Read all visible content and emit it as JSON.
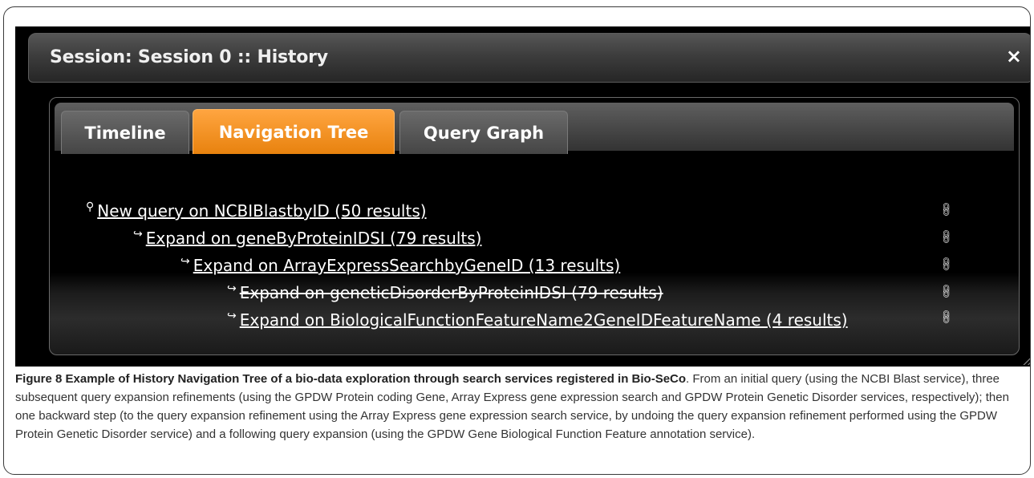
{
  "window": {
    "title": "Session: Session 0 :: History",
    "close_glyph": "×"
  },
  "tabs": [
    {
      "label": "Timeline",
      "active": false
    },
    {
      "label": "Navigation Tree",
      "active": true
    },
    {
      "label": "Query Graph",
      "active": false
    }
  ],
  "tree": [
    {
      "glyph": "⚲",
      "label": "New query on NCBIBlastbyID (50 results)",
      "icon": "link-icon",
      "struck": false
    },
    {
      "glyph": "↪",
      "label": "Expand on geneByProteinIDSI (79 results)",
      "icon": "link-icon",
      "struck": false
    },
    {
      "glyph": "↪",
      "label": "Expand on ArrayExpressSearchbyGeneID (13 results)",
      "icon": "link-icon",
      "struck": false
    },
    {
      "glyph": "↪",
      "label": "Expand on geneticDisorderByProteinIDSI (79 results)",
      "icon": "link-icon",
      "struck": true
    },
    {
      "glyph": "↪",
      "label": "Expand on BiologicalFunctionFeatureName2GeneIDFeatureName (4 results)",
      "icon": "link-icon",
      "struck": false
    }
  ],
  "caption": {
    "heading": "Figure 8 Example of History Navigation Tree of a bio-data exploration through search services registered in Bio-SeCo",
    "body": ". From an initial query (using the NCBI Blast service), three subsequent query expansion refinements (using the GPDW Protein coding Gene, Array Express gene expression search and GPDW Protein Genetic Disorder services, respectively); then one backward step (to the query expansion refinement using the Array Express gene expression search service, by undoing the query expansion refinement performed using the GPDW Protein Genetic Disorder service) and a following query expansion (using the GPDW Gene Biological Function Feature annotation service)."
  },
  "colors": {
    "active_tab": "#f39425",
    "background": "#000000",
    "text": "#ffffff"
  }
}
